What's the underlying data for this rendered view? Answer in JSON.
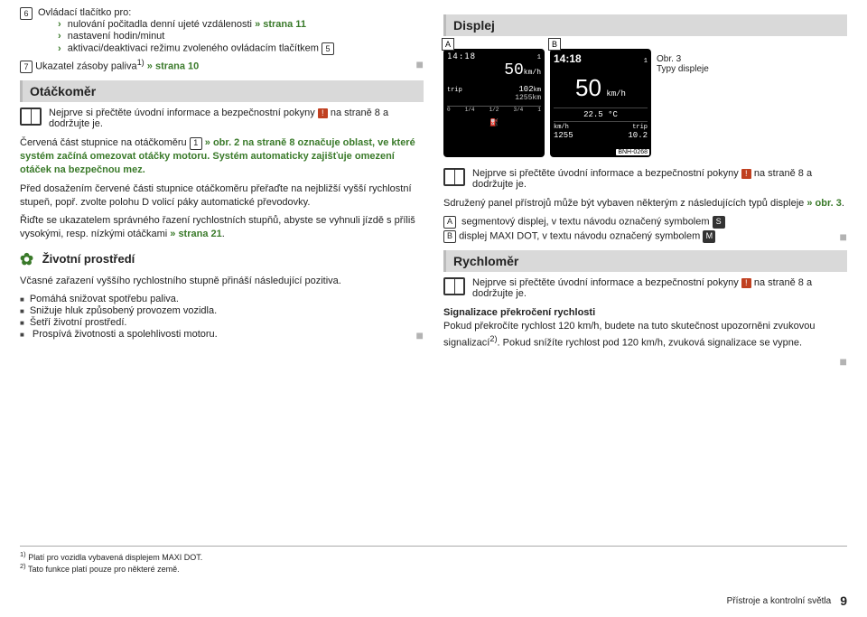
{
  "left": {
    "item6_label": "Ovládací tlačítko pro:",
    "item6_sublist": [
      {
        "text": "nulování počitadla denní ujeté vzdálenosti",
        "link": "» strana 11"
      },
      {
        "text": "nastavení hodin/minut",
        "link": ""
      },
      {
        "text": "aktivaci/deaktivaci režimu zvoleného ovládacím tlačítkem",
        "link": "",
        "box": "5"
      }
    ],
    "item7_label": "Ukazatel zásoby paliva",
    "item7_sup": "1)",
    "item7_link": "» strana 10",
    "sec1_title": "Otáčkoměr",
    "book1": "Nejprve si přečtěte úvodní informace a bezpečnostní pokyny",
    "book1_tail": "na straně 8 a dodržujte je.",
    "para1a": "Červená část stupnice na otáčkoměru",
    "para1b": "» obr. 2 na straně 8 označuje oblast, ve které systém začíná omezovat otáčky motoru. Systém automaticky zajišťuje omezení otáček na bezpečnou mez.",
    "para2": "Před dosažením červené části stupnice otáčkoměru přeřaďte na nejbližší vyšší rychlostní stupeň, popř. zvolte polohu D volicí páky automatické převodovky.",
    "para3a": "Řiďte se ukazatelem správného řazení rychlostních stupňů, abyste se vyhnuli jízdě s příliš vysokými, resp. nízkými otáčkami",
    "para3b": "» strana 21",
    "env_title": "Životní prostředí",
    "env_lead": "Včasné zařazení vyššího rychlostního stupně přináší následující pozitiva.",
    "env_bullets": [
      "Pomáhá snižovat spotřebu paliva.",
      "Snižuje hluk způsobený provozem vozidla.",
      "Šetří životní prostředí.",
      "Prospívá životnosti a spolehlivosti motoru."
    ]
  },
  "right": {
    "sec_title": "Displej",
    "obr": "Obr. 3",
    "obr_sub": "Typy displeje",
    "panelA": {
      "letter": "A",
      "time": "14:18",
      "speed": "50",
      "speed_unit": "km/h",
      "trip": "trip",
      "trip1": "102",
      "trip1_unit": "km",
      "trip2": "1255",
      "trip2_unit": "km",
      "gauge": [
        "0",
        "1/4",
        "1/2",
        "3/4",
        "1"
      ],
      "fuel": "⛽"
    },
    "panelB": {
      "letter": "B",
      "time": "14:18",
      "speed": "50",
      "speed_unit": "km/h",
      "temp": "22.5 °C",
      "kmh_lbl": "km/h",
      "km": "1255",
      "trip_lbl": "trip",
      "tripv": "10.2",
      "imgnum": "BNH-0268"
    },
    "book2": "Nejprve si přečtěte úvodní informace a bezpečnostní pokyny",
    "book2_tail": "na straně 8 a dodržujte je.",
    "para1a": "Sdružený panel přístrojů může být vybaven některým z následujících typů displeje",
    "para1b": "» obr. 3",
    "listA": "segmentový displej, v textu návodu označený symbolem",
    "listA_box": "S",
    "listB": "displej MAXI DOT, v textu návodu označený symbolem",
    "listB_box": "M",
    "sec2_title": "Rychloměr",
    "book3": "Nejprve si přečtěte úvodní informace a bezpečnostní pokyny",
    "book3_tail": "na straně 8 a dodržujte je.",
    "spd_head": "Signalizace překročení rychlosti",
    "spd_p1": "Pokud překročíte rychlost 120 km/h, budete na tuto skutečnost upozorněni zvukovou signalizací",
    "spd_sup": "2)",
    "spd_p2": ". Pokud snížíte rychlost pod 120 km/h, zvuková signalizace se vypne."
  },
  "footnotes": {
    "f1": "Platí pro vozidla vybavená displejem MAXI DOT.",
    "f2": "Tato funkce platí pouze pro některé země."
  },
  "footer": {
    "section": "Přístroje a kontrolní světla",
    "page": "9"
  }
}
